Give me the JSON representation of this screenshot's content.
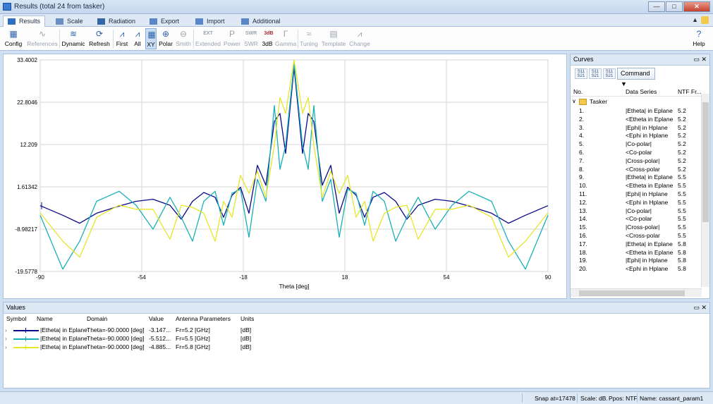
{
  "window": {
    "title": "Results (total 24 from tasker)",
    "min_glyph": "—",
    "max_glyph": "□",
    "close_glyph": "✕"
  },
  "tabs": [
    {
      "label": "Results",
      "active": true,
      "color": "#2f6fbf"
    },
    {
      "label": "Scale",
      "active": false,
      "color": "#6b8ec2"
    },
    {
      "label": "Radiation",
      "active": false,
      "color": "#3465a4"
    },
    {
      "label": "Export",
      "active": false,
      "color": "#5b86c5"
    },
    {
      "label": "Import",
      "active": false,
      "color": "#5b86c5"
    },
    {
      "label": "Additional",
      "active": false,
      "color": "#5b86c5"
    }
  ],
  "tabs_right": {
    "glyph": "▲"
  },
  "toolbar": [
    {
      "label": "Config",
      "icon": "config-icon",
      "glyph": "▦",
      "enabled": true
    },
    {
      "label": "References",
      "icon": "references-icon",
      "glyph": "∿",
      "enabled": false
    },
    {
      "label": "Dynamic",
      "icon": "dynamic-icon",
      "glyph": "≋",
      "enabled": true
    },
    {
      "label": "Refresh",
      "icon": "refresh-icon",
      "glyph": "⟳",
      "enabled": true
    },
    {
      "label": "First",
      "icon": "first-icon",
      "glyph": "⩘",
      "enabled": true
    },
    {
      "label": "All",
      "icon": "all-icon",
      "glyph": "⩘",
      "enabled": true
    },
    {
      "label": "XY",
      "icon": "xy-icon",
      "glyph": "▦",
      "enabled": true,
      "selected": true
    },
    {
      "label": "Polar",
      "icon": "polar-icon",
      "glyph": "⊕",
      "enabled": true
    },
    {
      "label": "Smith",
      "icon": "smith-icon",
      "glyph": "⊖",
      "enabled": false
    },
    {
      "label": "Extended",
      "icon": "extended-icon",
      "glyph": "EXT",
      "enabled": false
    },
    {
      "label": "Power",
      "icon": "power-icon",
      "glyph": "P",
      "enabled": false
    },
    {
      "label": "SWR",
      "icon": "swr-icon",
      "glyph": "SWR",
      "enabled": false
    },
    {
      "label": "3dB",
      "icon": "3db-icon",
      "glyph": "3dB",
      "enabled": true
    },
    {
      "label": "Gamma",
      "icon": "gamma-icon",
      "glyph": "Γ",
      "enabled": false
    },
    {
      "label": "Tuning",
      "icon": "tuning-icon",
      "glyph": "≈",
      "enabled": false
    },
    {
      "label": "Template",
      "icon": "template-icon",
      "glyph": "▤",
      "enabled": false
    },
    {
      "label": "Change",
      "icon": "change-icon",
      "glyph": "⩘",
      "enabled": false
    },
    {
      "label": "Help",
      "icon": "help-icon",
      "glyph": "?",
      "enabled": true
    }
  ],
  "chart_data": {
    "type": "line",
    "xlabel": "Theta [deg]",
    "xlim": [
      -90,
      90
    ],
    "ylim": [
      -19.5778,
      33.4002
    ],
    "xticks": [
      -90,
      -54,
      -18,
      18,
      54,
      90
    ],
    "xtick_labels": [
      "-90",
      "-54",
      "-18",
      "18",
      "54",
      "90"
    ],
    "yticks": [
      -19.5778,
      -8.98217,
      1.61342,
      12.209,
      22.8046,
      33.4002
    ],
    "ytick_labels": [
      "-19.5778",
      "-8.98217",
      "1.61342",
      "12.209",
      "22.8046",
      "33.4002"
    ],
    "grid": true,
    "x": [
      -90,
      -82,
      -76,
      -70,
      -62,
      -56,
      -50,
      -44,
      -40,
      -36,
      -32,
      -28,
      -25,
      -22,
      -19,
      -16,
      -13,
      -10,
      -7,
      -5,
      -3,
      0,
      3,
      5,
      7,
      10,
      13,
      16,
      19,
      22,
      25,
      28,
      32,
      36,
      40,
      44,
      50,
      56,
      62,
      70,
      76,
      82,
      90
    ],
    "series": [
      {
        "color": "#0a0a8a",
        "values": [
          -3.1,
          -5.5,
          -7.5,
          -5.0,
          -3.2,
          -2.0,
          -1.5,
          -3.0,
          -6.5,
          -2.0,
          0.2,
          -1.0,
          -6.0,
          -0.5,
          1.5,
          -5.0,
          7.0,
          2.0,
          18.0,
          20.0,
          10.0,
          31.5,
          10.0,
          20.0,
          18.0,
          2.0,
          7.0,
          -5.0,
          1.5,
          -0.5,
          -6.0,
          -1.0,
          0.2,
          -2.0,
          -6.5,
          -3.0,
          -1.5,
          -2.0,
          -3.2,
          -5.0,
          -7.5,
          -5.5,
          -3.1
        ]
      },
      {
        "color": "#1ab0b8",
        "values": [
          -5.5,
          -19.0,
          -12.0,
          -2.0,
          0.5,
          -3.0,
          -9.0,
          -1.0,
          -6.0,
          -12.0,
          -2.0,
          0.5,
          -8.0,
          0.0,
          1.0,
          -11.0,
          3.5,
          -2.0,
          22.0,
          6.0,
          12.0,
          32.5,
          12.0,
          6.0,
          22.0,
          -2.0,
          3.5,
          -11.0,
          1.0,
          0.0,
          -8.0,
          0.5,
          -2.0,
          -12.0,
          -6.0,
          -1.0,
          -9.0,
          -3.0,
          0.5,
          -2.0,
          -12.0,
          -19.0,
          -5.5
        ]
      },
      {
        "color": "#e6e629",
        "values": [
          -4.9,
          -12.0,
          -16.0,
          -6.0,
          -3.0,
          -4.0,
          -4.0,
          -11.5,
          -3.0,
          -3.5,
          -5.0,
          -12.0,
          -2.0,
          -6.0,
          4.5,
          0.0,
          5.5,
          -1.0,
          12.0,
          24.0,
          20.0,
          33.4,
          20.0,
          24.0,
          12.0,
          -1.0,
          5.5,
          0.0,
          4.5,
          -6.0,
          -2.0,
          -12.0,
          -5.0,
          -3.5,
          -3.0,
          -11.5,
          -4.0,
          -4.0,
          -3.0,
          -6.0,
          -16.0,
          -12.0,
          -4.9
        ]
      }
    ]
  },
  "curves": {
    "title": "Curves",
    "title_buttons": "▭ ✕",
    "buttons": [
      "S11 S21",
      "S11 S21",
      "S11 S21"
    ],
    "command_label": "Command ▼",
    "columns": [
      "No.",
      "Data Series",
      "NTF Fr..."
    ],
    "group": "Tasker",
    "items": [
      {
        "no": "1.",
        "series": "|Etheta| in Eplane",
        "fr": "5.2"
      },
      {
        "no": "2.",
        "series": "<Etheta in Eplane",
        "fr": "5.2"
      },
      {
        "no": "3.",
        "series": "|Ephi| in Hplane",
        "fr": "5.2"
      },
      {
        "no": "4.",
        "series": "<Ephi in Hplane",
        "fr": "5.2"
      },
      {
        "no": "5.",
        "series": "|Co-polar|",
        "fr": "5.2"
      },
      {
        "no": "6.",
        "series": "<Co-polar",
        "fr": "5.2"
      },
      {
        "no": "7.",
        "series": "|Cross-polar|",
        "fr": "5.2"
      },
      {
        "no": "8.",
        "series": "<Cross-polar",
        "fr": "5.2"
      },
      {
        "no": "9.",
        "series": "|Etheta| in Eplane",
        "fr": "5.5"
      },
      {
        "no": "10.",
        "series": "<Etheta in Eplane",
        "fr": "5.5"
      },
      {
        "no": "11.",
        "series": "|Ephi| in Hplane",
        "fr": "5.5"
      },
      {
        "no": "12.",
        "series": "<Ephi in Hplane",
        "fr": "5.5"
      },
      {
        "no": "13.",
        "series": "|Co-polar|",
        "fr": "5.5"
      },
      {
        "no": "14.",
        "series": "<Co-polar",
        "fr": "5.5"
      },
      {
        "no": "15.",
        "series": "|Cross-polar|",
        "fr": "5.5"
      },
      {
        "no": "16.",
        "series": "<Cross-polar",
        "fr": "5.5"
      },
      {
        "no": "17.",
        "series": "|Etheta| in Eplane",
        "fr": "5.8"
      },
      {
        "no": "18.",
        "series": "<Etheta in Eplane",
        "fr": "5.8"
      },
      {
        "no": "19.",
        "series": "|Ephi| in Hplane",
        "fr": "5.8"
      },
      {
        "no": "20.",
        "series": "<Ephi in Hplane",
        "fr": "5.8"
      }
    ]
  },
  "values": {
    "title": "Values",
    "title_buttons": "▭ ✕",
    "columns": [
      "Symbol",
      "Name",
      "Domain",
      "Value",
      "Antenna Parameters",
      "Units"
    ],
    "rows": [
      {
        "color": "#0a0a8a",
        "name": "|Etheta| in Eplane",
        "domain": "Theta=-90.0000 [deg]",
        "value": "-3.147...",
        "params": "Fr=5.2 [GHz]",
        "units": "[dB]"
      },
      {
        "color": "#1ab0b8",
        "name": "|Etheta| in Eplane",
        "domain": "Theta=-90.0000 [deg]",
        "value": "-5.512...",
        "params": "Fr=5.5 [GHz]",
        "units": "[dB]"
      },
      {
        "color": "#e6e629",
        "name": "|Etheta| in Eplane",
        "domain": "Theta=-90.0000 [deg]",
        "value": "-4.885...",
        "params": "Fr=5.8 [GHz]",
        "units": "[dB]"
      }
    ]
  },
  "status": {
    "snap": "Snap at=17478",
    "scale": "Scale: dB.",
    "ppos": "Ppos: NTF",
    "name": "Name: cassant_param1"
  }
}
